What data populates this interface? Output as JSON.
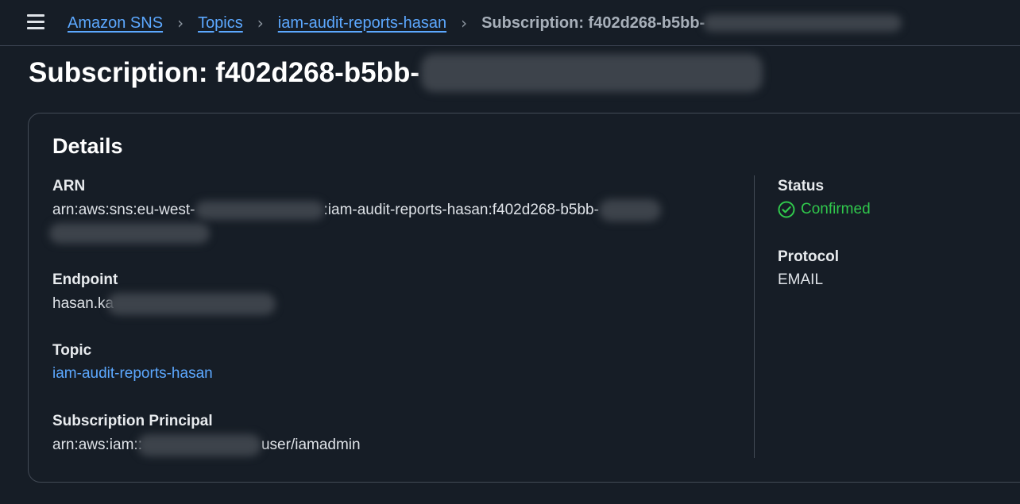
{
  "breadcrumb": {
    "items": [
      "Amazon SNS",
      "Topics",
      "iam-audit-reports-hasan"
    ],
    "current": "Subscription: f402d268-b5bb-"
  },
  "page": {
    "title": "Subscription: f402d268-b5bb-"
  },
  "details": {
    "heading": "Details",
    "arn": {
      "label": "ARN",
      "value_part1": "arn:aws:sns:eu-west-",
      "value_part2": ":iam-audit-reports-hasan:f402d268-b5bb-"
    },
    "endpoint": {
      "label": "Endpoint",
      "value": "hasan.ka"
    },
    "topic": {
      "label": "Topic",
      "value": "iam-audit-reports-hasan"
    },
    "principal": {
      "label": "Subscription Principal",
      "value_part1": "arn:aws:iam::",
      "value_part2": "user/iamadmin"
    },
    "status": {
      "label": "Status",
      "value": "Confirmed",
      "icon": "check-circle-icon",
      "color": "#30c84c"
    },
    "protocol": {
      "label": "Protocol",
      "value": "EMAIL"
    }
  }
}
